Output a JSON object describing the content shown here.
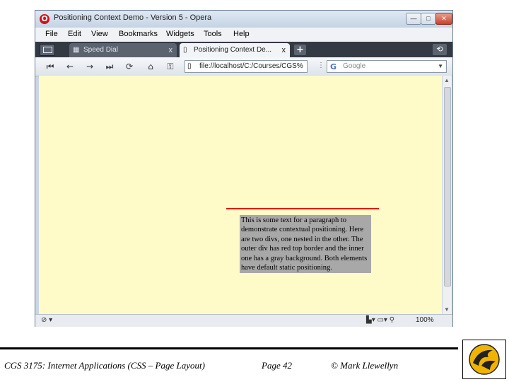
{
  "window": {
    "title": "Positioning Context Demo - Version 5 - Opera",
    "buttons": {
      "minimize": "—",
      "maximize": "□",
      "close": "✕"
    }
  },
  "menubar": [
    "File",
    "Edit",
    "View",
    "Bookmarks",
    "Widgets",
    "Tools",
    "Help"
  ],
  "tabs": [
    {
      "label": "Speed Dial",
      "close": "x",
      "icon": "grid-icon"
    },
    {
      "label": "Positioning Context De...",
      "close": "x",
      "icon": "page-icon"
    }
  ],
  "toolbar": {
    "address": "file://localhost/C:/Courses/CGS%",
    "search_placeholder": "Google"
  },
  "content": {
    "paragraph": "This is some text for a paragraph to demonstrate contextual positioning. Here are two divs, one nested in the other. The outer div has red top border and the inner one has a gray background. Both elements have default static positioning."
  },
  "statusbar": {
    "zoom": "100%"
  },
  "footer": {
    "course": "CGS 3175: Internet Applications (CSS – Page Layout)",
    "page": "Page 42",
    "author": "© Mark Llewellyn"
  },
  "colors": {
    "page_background": "#fefbc8",
    "outer_border": "#e01a10",
    "inner_background": "#a8a8a8"
  }
}
